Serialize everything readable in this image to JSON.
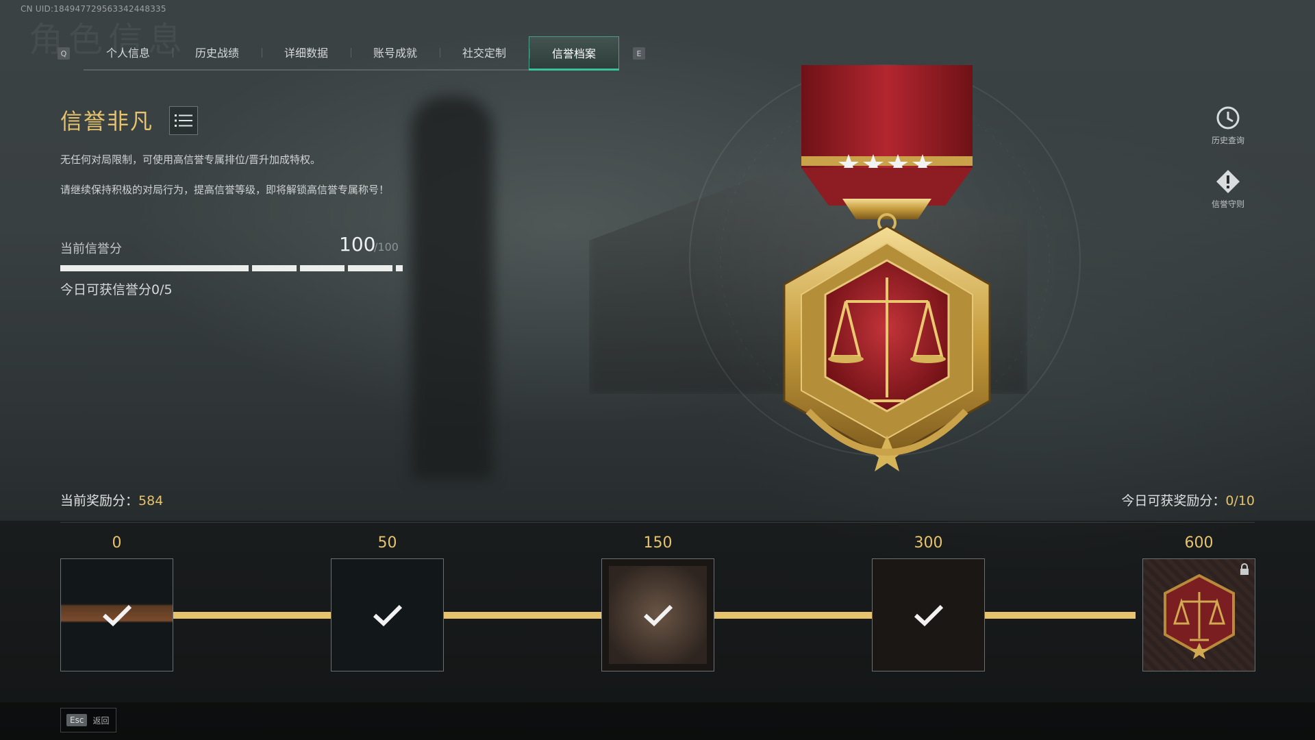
{
  "uid": "CN UID:184947729563342448335",
  "ghost_title": "角色信息",
  "tabs": {
    "prev_key": "Q",
    "next_key": "E",
    "items": [
      "个人信息",
      "历史战绩",
      "详细数据",
      "账号成就",
      "社交定制",
      "信誉档案"
    ],
    "active_index": 5
  },
  "honor": {
    "title": "信誉非凡",
    "desc1": "无任何对局限制，可使用高信誉专属排位/晋升加成特权。",
    "desc2": "请继续保持积极的对局行为，提高信誉等级，即将解锁高信誉专属称号！",
    "credit_label": "当前信誉分",
    "credit_value": "100",
    "credit_max": "/100",
    "credit_fraction": 1.0,
    "today_credit": "今日可获信誉分0/5"
  },
  "side": {
    "history": "历史查询",
    "rules": "信誉守则"
  },
  "reward": {
    "label": "当前奖励分：",
    "value": "584",
    "today_label": "今日可获奖励分：",
    "today_value": "0/10",
    "tiers": [
      {
        "threshold": "0",
        "claimed": true
      },
      {
        "threshold": "50",
        "claimed": true
      },
      {
        "threshold": "150",
        "claimed": true
      },
      {
        "threshold": "300",
        "claimed": true
      },
      {
        "threshold": "600",
        "claimed": false,
        "locked": true
      }
    ]
  },
  "footer": {
    "esc_key": "Esc",
    "esc_label": "返回"
  },
  "colors": {
    "accent_gold": "#e6c36c",
    "accent_green": "#39c39a",
    "medal_red": "#a3222a"
  }
}
